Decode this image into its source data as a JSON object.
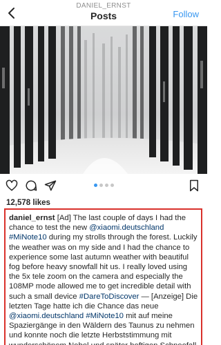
{
  "header": {
    "username": "DANIEL_ERNST",
    "title": "Posts",
    "follow_label": "Follow"
  },
  "post": {
    "likes": "12,578 likes",
    "carousel": {
      "count": 4,
      "active_index": 0
    },
    "caption": {
      "username": "daniel_ernst",
      "parts": [
        {
          "text": " [Ad] The last couple of days I had the chance to test the new "
        },
        {
          "text": "@xiaomi.deutschland",
          "link": true
        },
        {
          "text": " "
        },
        {
          "text": "#MiNote10",
          "link": true
        },
        {
          "text": " during my strolls through the forest. Luckily the weather was on my side and I had the chance to experience some last autumn weather with beautiful fog before heavy snowfall hit us. I really loved using the 5x tele zoom on the camera and especially the 108MP mode allowed me to get incredible detail with such a small device "
        },
        {
          "text": "#DareToDiscover",
          "link": true
        },
        {
          "text": " — [Anzeige] Die letzten Tage hatte ich die Chance das neue "
        },
        {
          "text": "@xiaomi.deutschland",
          "link": true
        },
        {
          "text": " "
        },
        {
          "text": "#MiNote10",
          "link": true
        },
        {
          "text": " mit auf meine Spaziergänge in den Wäldern des Taunus zu nehmen und konnte noch die letzte Herbststimmung mit wunderschönem Nebel und später heftigen Schneefall einfangen. Ein 108MP"
        }
      ]
    }
  },
  "icons": {
    "back": "chevron-left-icon",
    "like": "heart-icon",
    "comment": "comment-icon",
    "share": "send-icon",
    "save": "bookmark-icon"
  },
  "colors": {
    "link": "#003569",
    "follow": "#3897f0",
    "highlight_border": "#d9302a",
    "carousel_active": "#3897f0",
    "carousel_inactive": "#c7c7c7"
  }
}
